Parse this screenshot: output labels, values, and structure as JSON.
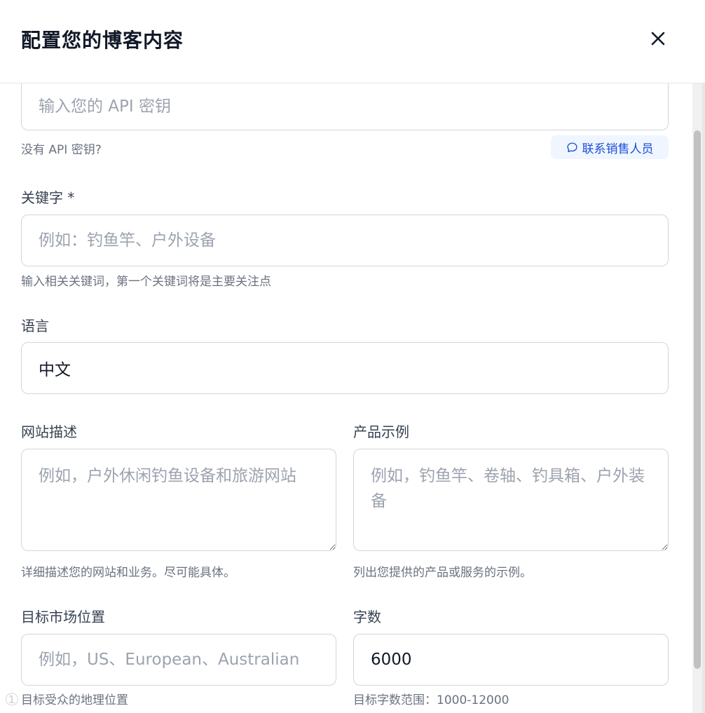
{
  "header": {
    "title": "配置您的博客内容"
  },
  "api_key": {
    "placeholder": "输入您的 API 密钥",
    "value": "",
    "no_key_text": "没有 API 密钥?",
    "contact_sales_label": "联系销售人员"
  },
  "keywords": {
    "label": "关键字 *",
    "placeholder": "例如：钓鱼竿、户外设备",
    "value": "",
    "hint": "输入相关关键词，第一个关键词将是主要关注点"
  },
  "language": {
    "label": "语言",
    "value": "中文"
  },
  "website_description": {
    "label": "网站描述",
    "placeholder": "例如，户外休闲钓鱼设备和旅游网站",
    "value": "",
    "hint": "详细描述您的网站和业务。尽可能具体。"
  },
  "product_examples": {
    "label": "产品示例",
    "placeholder": "例如，钓鱼竿、卷轴、钓具箱、户外装备",
    "value": "",
    "hint": "列出您提供的产品或服务的示例。"
  },
  "target_market": {
    "label": "目标市场位置",
    "placeholder": "例如，US、European、Australian",
    "value": "",
    "hint": "目标受众的地理位置"
  },
  "word_count": {
    "label": "字数",
    "value": "6000",
    "hint": "目标字数范围：1000-12000"
  },
  "watermark": "①"
}
